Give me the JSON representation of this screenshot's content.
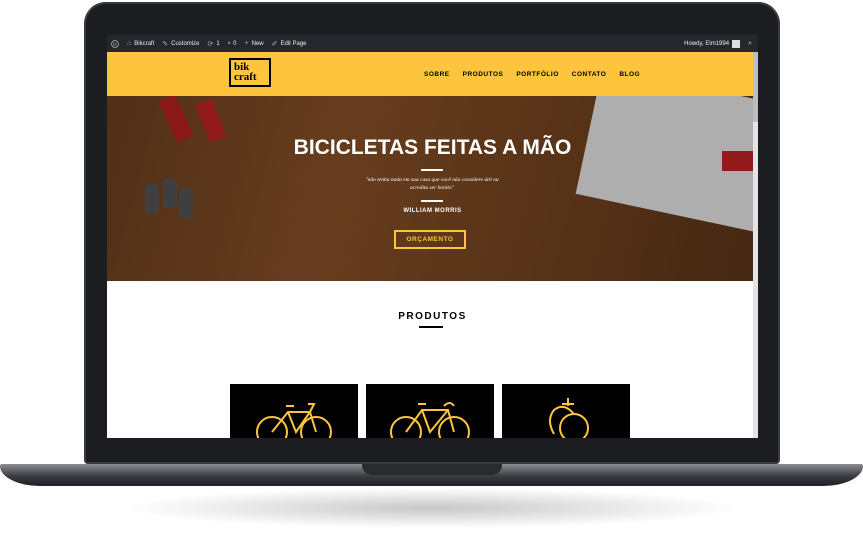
{
  "admin_bar": {
    "site_name": "Bikcraft",
    "customize": "Customize",
    "updates_count": "1",
    "comments_count": "0",
    "new_label": "New",
    "edit_page": "Edit Page",
    "howdy": "Howdy, Elm1994"
  },
  "header": {
    "logo_line1": "bik",
    "logo_line2": "craft",
    "nav": [
      "SOBRE",
      "PRODUTOS",
      "PORTFÓLIO",
      "CONTATO",
      "BLOG"
    ]
  },
  "hero": {
    "title": "BICICLETAS FEITAS A MÃO",
    "quote": "\"não tenha nada em sua casa que você não considere útil ou acredita ser bonito\"",
    "author": "WILLIAM MORRIS",
    "cta": "ORÇAMENTO"
  },
  "produtos": {
    "title": "PRODUTOS",
    "cards": [
      {
        "icon": "bicycle-icon"
      },
      {
        "icon": "road-bike-icon"
      },
      {
        "icon": "unicycle-icon"
      }
    ]
  },
  "colors": {
    "accent": "#fdc43d",
    "admin_bar": "#23282d",
    "card_bg": "#000000"
  }
}
